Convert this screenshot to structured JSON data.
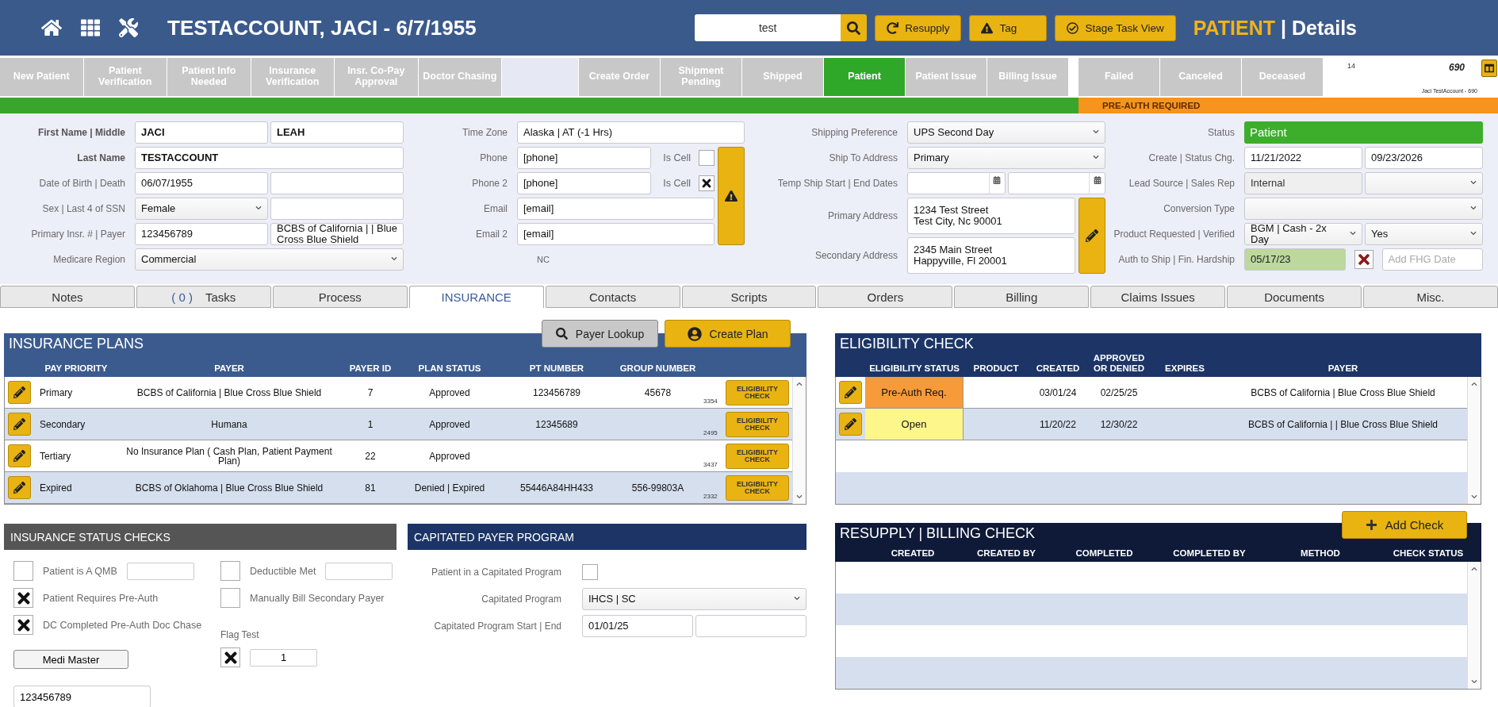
{
  "header": {
    "title": "TESTACCOUNT, JACI - 6/7/1955",
    "search": {
      "value": "test"
    },
    "actions": [
      {
        "label": "Resupply",
        "kind": "refresh"
      },
      {
        "label": "Tag",
        "kind": "warning"
      },
      {
        "label": "Stage Task View",
        "kind": "check"
      }
    ],
    "page_title": {
      "section": "PATIENT",
      "separator": "|",
      "view": "Details"
    }
  },
  "stage_groups": [
    [
      {
        "label": "New Patient",
        "selected": false
      },
      {
        "label": "Patient Verification",
        "selected": false
      },
      {
        "label": "Patient Info Needed",
        "selected": false
      },
      {
        "label": "Insurance Verification",
        "selected": false
      },
      {
        "label": "Insr. Co-Pay Approval",
        "selected": false
      },
      {
        "label": "Doctor Chasing",
        "selected": false
      }
    ],
    [
      {
        "label": "Create Order",
        "selected": false
      },
      {
        "label": "Shipment Pending",
        "selected": false
      },
      {
        "label": "Shipped",
        "selected": false
      },
      {
        "label": "Patient",
        "selected": true
      },
      {
        "label": "Patient Issue",
        "selected": false
      },
      {
        "label": "Billing Issue",
        "selected": false
      }
    ],
    [
      {
        "label": "Failed",
        "selected": false
      },
      {
        "label": "Canceled",
        "selected": false
      },
      {
        "label": "Deceased",
        "selected": false
      }
    ]
  ],
  "record": {
    "count": "14",
    "number": "690",
    "caption": "Jaci TestAccount - 690"
  },
  "alert": {
    "level": 0.72,
    "text": "PRE-AUTH REQUIRED"
  },
  "form_columns": [
    {
      "rows": [
        {
          "label": "First Name | Middle",
          "label_bold": true,
          "fields": [
            {
              "kind": "text",
              "value": "JACI",
              "bold": true
            },
            {
              "kind": "text",
              "value": "LEAH",
              "bold": true
            }
          ]
        },
        {
          "label": "Last Name",
          "label_bold": true,
          "fields": [
            {
              "kind": "text",
              "value": "TESTACCOUNT",
              "bold": true
            }
          ]
        },
        {
          "label": "Date of Birth | Death",
          "fields": [
            {
              "kind": "text",
              "value": "06/07/1955"
            },
            {
              "kind": "text"
            }
          ]
        },
        {
          "label": "Sex | Last 4 of SSN",
          "fields": [
            {
              "kind": "select",
              "value": "Female"
            },
            {
              "kind": "text"
            }
          ]
        },
        {
          "label": "Primary Insr. # | Payer",
          "fields": [
            {
              "kind": "text",
              "value": "123456789"
            },
            {
              "kind": "text",
              "value": "BCBS of California | | Blue Cross Blue Shield"
            }
          ]
        },
        {
          "label": "Medicare Region",
          "fields": [
            {
              "kind": "select",
              "value": "Commercial"
            }
          ]
        }
      ]
    },
    {
      "rows": [
        {
          "label": "Time Zone",
          "fields": [
            {
              "kind": "text",
              "value": "Alaska | AT (-1 Hrs)"
            }
          ]
        },
        {
          "kind": "warning_group",
          "rows": [
            {
              "label": "Phone",
              "fields": [
                {
                  "kind": "text",
                  "value": "[phone]"
                },
                {
                  "kind": "checkbox",
                  "label": "Is Cell",
                  "checked": false
                }
              ]
            },
            {
              "label": "Phone 2",
              "fields": [
                {
                  "kind": "text",
                  "value": "[phone]"
                },
                {
                  "kind": "checkbox",
                  "label": "Is Cell",
                  "checked": true
                }
              ]
            },
            {
              "label": "Email",
              "fields": [
                {
                  "kind": "text",
                  "value": "[email]"
                }
              ]
            },
            {
              "label": "Email 2",
              "fields": [
                {
                  "kind": "text",
                  "value": "[email]"
                }
              ]
            }
          ]
        },
        {
          "kind": "note",
          "text": "NC"
        }
      ]
    },
    {
      "rows": [
        {
          "label": "Shipping Preference",
          "fields": [
            {
              "kind": "select",
              "value": "UPS Second Day"
            }
          ]
        },
        {
          "label": "Ship To Address",
          "fields": [
            {
              "kind": "select",
              "value": "Primary"
            }
          ]
        },
        {
          "label": "Temp Ship Start | End Dates",
          "fields": [
            {
              "kind": "date"
            },
            {
              "kind": "date"
            }
          ]
        },
        {
          "kind": "edit_group",
          "rows": [
            {
              "label": "Primary Address",
              "fields": [
                {
                  "kind": "address",
                  "value": "1234 Test Street\nTest City, Nc 90001"
                }
              ]
            },
            {
              "label": "Secondary Address",
              "fields": [
                {
                  "kind": "address",
                  "value": "2345 Main Street\nHappyville, Fl 20001"
                }
              ]
            }
          ]
        }
      ]
    },
    {
      "rows": [
        {
          "label": "Status",
          "fields": [
            {
              "kind": "status",
              "value": "Patient"
            }
          ]
        },
        {
          "label": "Create | Status Chg.",
          "fields": [
            {
              "kind": "text",
              "value": "11/21/2022"
            },
            {
              "kind": "text",
              "value": "09/23/2026"
            }
          ]
        },
        {
          "label": "Lead Source | Sales Rep",
          "fields": [
            {
              "kind": "readonly",
              "value": "Internal"
            },
            {
              "kind": "select"
            }
          ]
        },
        {
          "label": "Conversion Type",
          "fields": [
            {
              "kind": "select"
            }
          ]
        },
        {
          "label": "Product Requested | Verified",
          "fields": [
            {
              "kind": "select",
              "value": "BGM | Cash - 2x Day"
            },
            {
              "kind": "select",
              "value": "Yes"
            }
          ]
        },
        {
          "label": "Auth to Ship | Fin. Hardship",
          "fields": [
            {
              "kind": "approved",
              "value": "05/17/23"
            },
            {
              "kind": "flag",
              "checked": true
            },
            {
              "kind": "text",
              "placeholder": "Add FHG Date"
            }
          ]
        }
      ]
    }
  ],
  "tabs": [
    {
      "label": "Notes",
      "selected": false
    },
    {
      "label": "Tasks",
      "badge": "( 0 )",
      "selected": false
    },
    {
      "label": "Process",
      "selected": false
    },
    {
      "label": "INSURANCE",
      "selected": true
    },
    {
      "label": "Contacts",
      "selected": false
    },
    {
      "label": "Scripts",
      "selected": false
    },
    {
      "label": "Orders",
      "selected": false
    },
    {
      "label": "Billing",
      "selected": false
    },
    {
      "label": "Claims Issues",
      "selected": false
    },
    {
      "label": "Documents",
      "selected": false
    },
    {
      "label": "Misc.",
      "selected": false
    }
  ],
  "insurance_plans": {
    "title": "INSURANCE PLANS",
    "buttons": [
      {
        "label": "Payer Lookup",
        "kind": "search"
      },
      {
        "label": "Create Plan",
        "kind": "person"
      }
    ],
    "columns": [
      "PAY PRIORITY",
      "PAYER",
      "PAYER ID",
      "PLAN STATUS",
      "PT NUMBER",
      "GROUP NUMBER"
    ],
    "rows": [
      {
        "priority": "Primary",
        "payer": "BCBS of California | Blue Cross Blue Shield",
        "payer_id": "7",
        "plan_status": "Approved",
        "pt_number": "123456789",
        "group_number": "45678",
        "code": "3354",
        "action": "ELIGIBILITY CHECK"
      },
      {
        "priority": "Secondary",
        "payer": "Humana",
        "payer_id": "1",
        "plan_status": "Approved",
        "pt_number": "12345689",
        "code": "2495",
        "action": "ELIGIBILITY CHECK"
      },
      {
        "priority": "Tertiary",
        "payer": "No Insurance Plan ( Cash Plan, Patient Payment Plan)",
        "payer_id": "22",
        "plan_status": "Approved",
        "code": "3437",
        "action": "ELIGIBILITY CHECK"
      },
      {
        "priority": "Expired",
        "payer": "BCBS of Oklahoma | Blue Cross Blue Shield",
        "payer_id": "81",
        "plan_status": "Denied | Expired",
        "pt_number": "55446A84HH433",
        "group_number": "556-99803A",
        "code": "2332",
        "action": "ELIGIBILITY CHECK"
      }
    ]
  },
  "eligibility": {
    "title": "ELIGIBILITY CHECK",
    "columns": [
      "ELIGIBILITY STATUS",
      "PRODUCT",
      "CREATED",
      "APPROVED OR DENIED",
      "EXPIRES",
      "PAYER"
    ],
    "rows": [
      {
        "status": "Pre-Auth Req.",
        "color": "#f79a3a",
        "created": "03/01/24",
        "approved_or_denied": "02/25/25",
        "payer": "BCBS of California | Blue Cross Blue Shield"
      },
      {
        "status": "Open",
        "color": "#fdf68a",
        "created": "11/20/22",
        "approved_or_denied": "12/30/22",
        "payer": "BCBS of California | | Blue Cross Blue Shield"
      }
    ]
  },
  "status_checks": {
    "title": "INSURANCE STATUS CHECKS",
    "columns": [
      [
        {
          "kind": "check_input",
          "label": "Patient is A QMB",
          "checked": false
        },
        {
          "kind": "check",
          "label": "Patient Requires Pre-Auth",
          "checked": true
        },
        {
          "kind": "check",
          "label": "DC Completed Pre-Auth Doc Chase",
          "checked": true
        },
        {
          "kind": "button",
          "label": "Medi Master"
        },
        {
          "kind": "input",
          "value": "123456789"
        }
      ],
      [
        {
          "kind": "check_input",
          "label": "Deductible Met",
          "checked": false
        },
        {
          "kind": "check",
          "label": "Manually Bill Secondary Payer",
          "checked": false
        },
        {
          "kind": "caption",
          "text": "Flag Test"
        },
        {
          "kind": "check_input",
          "checked": true,
          "value": "1"
        }
      ]
    ]
  },
  "capitated": {
    "title": "CAPITATED PAYER PROGRAM",
    "rows": [
      {
        "label": "Patient in a Capitated Program",
        "fields": [
          {
            "kind": "checkbox",
            "checked": false
          }
        ]
      },
      {
        "label": "Capitated Program",
        "fields": [
          {
            "kind": "select",
            "value": "IHCS | SC"
          }
        ]
      },
      {
        "label": "Capitated Program Start | End",
        "fields": [
          {
            "kind": "text",
            "value": "01/01/25"
          },
          {
            "kind": "text"
          }
        ]
      }
    ]
  },
  "resupply": {
    "title": "RESUPPLY | BILLING CHECK",
    "button": {
      "label": "Add Check"
    },
    "columns": [
      "CREATED",
      "CREATED BY",
      "COMPLETED",
      "COMPLETED BY",
      "METHOD",
      "CHECK STATUS"
    ]
  }
}
